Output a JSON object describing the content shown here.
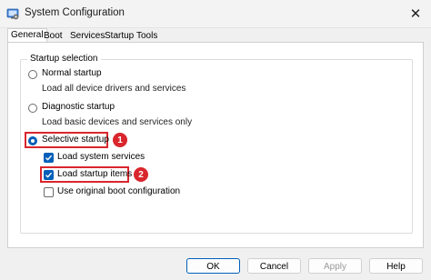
{
  "window": {
    "title": "System Configuration",
    "close_glyph": "✕"
  },
  "tabs": [
    {
      "label": "General",
      "active": true
    },
    {
      "label": "Boot"
    },
    {
      "label": "Services"
    },
    {
      "label": "Startup"
    },
    {
      "label": "Tools"
    }
  ],
  "startup_selection": {
    "group_label": "Startup selection",
    "normal": {
      "label": "Normal startup",
      "description": "Load all device drivers and services",
      "selected": false
    },
    "diagnostic": {
      "label": "Diagnostic startup",
      "description": "Load basic devices and services only",
      "selected": false
    },
    "selective": {
      "label": "Selective startup",
      "selected": true,
      "options": [
        {
          "label": "Load system services",
          "checked": true
        },
        {
          "label": "Load startup items",
          "checked": true
        },
        {
          "label": "Use original boot configuration",
          "checked": false
        }
      ]
    }
  },
  "annotations": {
    "step1": "1",
    "step2": "2",
    "highlight_color": "#d9262d"
  },
  "buttons": {
    "ok": "OK",
    "cancel": "Cancel",
    "apply": "Apply",
    "help": "Help"
  },
  "colors": {
    "accent": "#005fb8"
  }
}
